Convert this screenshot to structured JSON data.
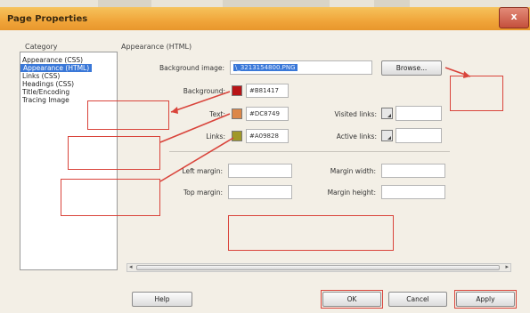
{
  "window": {
    "title": "Page Properties",
    "close_label": "x"
  },
  "category": {
    "label": "Category",
    "items": [
      {
        "label": "Appearance (CSS)"
      },
      {
        "label": "Appearance (HTML)"
      },
      {
        "label": "Links (CSS)"
      },
      {
        "label": "Headings (CSS)"
      },
      {
        "label": "Title/Encoding"
      },
      {
        "label": "Tracing Image"
      }
    ]
  },
  "section_title": "Appearance (HTML)",
  "form": {
    "background_image_label": "Background image:",
    "background_image_value": "\\_3213154800.PNG",
    "browse_label": "Browse...",
    "background_label": "Background:",
    "background_value": "#B81417",
    "text_label": "Text:",
    "text_value": "#DC8749",
    "links_label": "Links:",
    "links_value": "#A09828",
    "visited_label": "Visited links:",
    "active_label": "Active links:",
    "left_margin_label": "Left margin:",
    "top_margin_label": "Top margin:",
    "margin_width_label": "Margin width:",
    "margin_height_label": "Margin height:"
  },
  "buttons": {
    "help": "Help",
    "ok": "OK",
    "cancel": "Cancel",
    "apply": "Apply"
  },
  "colors": {
    "background_swatch": "#B81417",
    "text_swatch": "#DC8749",
    "links_swatch": "#A09828",
    "annotation": "#d9443b",
    "selection": "#3a78d8"
  }
}
